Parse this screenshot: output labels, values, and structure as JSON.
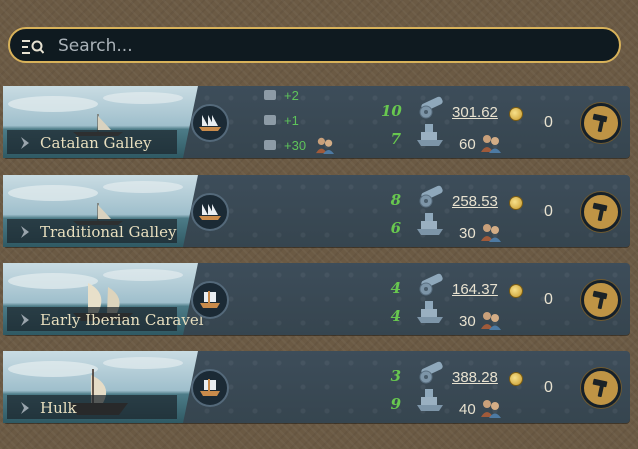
{
  "search": {
    "placeholder": "Search..."
  },
  "ships": [
    {
      "name": "Catalan Galley",
      "modifiers": [
        "+2",
        "+1",
        "+30"
      ],
      "cannons": "10",
      "hull": "7",
      "cost": "301.62",
      "crew": "60",
      "count": "0"
    },
    {
      "name": "Traditional Galley",
      "modifiers": [],
      "cannons": "8",
      "hull": "6",
      "cost": "258.53",
      "crew": "30",
      "count": "0"
    },
    {
      "name": "Early Iberian Caravel",
      "modifiers": [],
      "cannons": "4",
      "hull": "4",
      "cost": "164.37",
      "crew": "30",
      "count": "0"
    },
    {
      "name": "Hulk",
      "modifiers": [],
      "cannons": "3",
      "hull": "9",
      "cost": "388.28",
      "crew": "40",
      "count": "0"
    }
  ],
  "icons": {
    "filter": "filter-list-icon",
    "ship_type_galley": "galley-icon",
    "ship_type_sail": "sailing-ship-icon",
    "cannon": "cannon-icon",
    "hull": "hull-icon",
    "gold": "gold-coin-icon",
    "crew": "crew-icon",
    "build": "hammer-icon"
  },
  "colors": {
    "accent": "#d8b25a",
    "positive": "#5ec45a",
    "card": "#3b4b57",
    "build": "#bf9445"
  }
}
